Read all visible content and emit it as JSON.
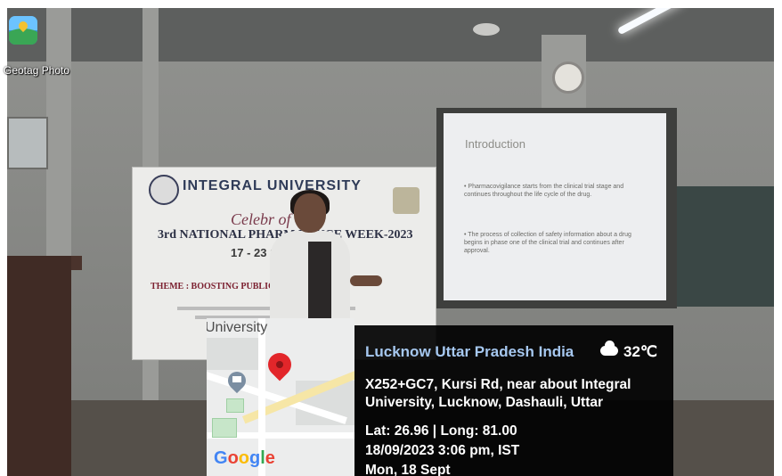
{
  "app": {
    "name": "Geotag Photo"
  },
  "scene": {
    "slide": {
      "title": "Introduction",
      "bullets": [
        "• Pharmacovigilance starts from the clinical trial stage and continues throughout the life cycle of the drug.",
        "• The process of collection of safety information about a drug begins in phase one of the clinical trial and continues after approval."
      ]
    },
    "banner": {
      "university": "INTEGRAL UNIVERSITY",
      "celebration": "Celebr        of",
      "event": "3rd NATIONAL PHARM         LANCE WEEK-2023",
      "dates": "17 - 23 S          2023",
      "theme": "THEME : BOOSTING PUBLIC               COVIGILANCE"
    }
  },
  "map": {
    "place_label": "University",
    "provider": "Google",
    "colors": {
      "pin": "#e2262a",
      "accent": "#a6c8f0"
    }
  },
  "geotag": {
    "location": "Lucknow Uttar Pradesh India",
    "temperature": "32℃",
    "weather_icon": "cloud-icon",
    "address_line1": "X252+GC7, Kursi Rd, near about Integral",
    "address_line2": "University, Lucknow, Dashauli, Uttar",
    "coords": "Lat: 26.96 | Long: 81.00",
    "datetime": "18/09/2023  3:06 pm, IST",
    "day": "Mon, 18 Sept"
  }
}
